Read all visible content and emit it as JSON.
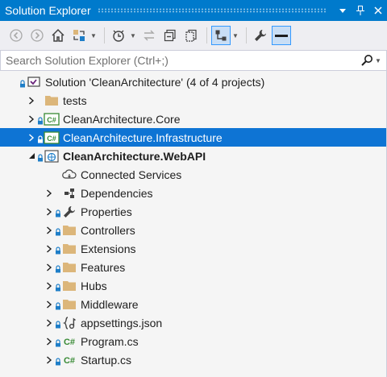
{
  "window": {
    "title": "Solution Explorer",
    "pin_glyph": "▾",
    "autohide_glyph": "⊥",
    "close_glyph": "✕"
  },
  "search": {
    "placeholder": "Search Solution Explorer (Ctrl+;)",
    "value": ""
  },
  "tree": [
    {
      "label": "Solution 'CleanArchitecture' (4 of 4 projects)",
      "icon": "solution-icon",
      "indent": 0,
      "expander": "none",
      "lock": true,
      "selected": false,
      "bold": false
    },
    {
      "label": "tests",
      "icon": "folder-icon",
      "indent": 1,
      "expander": "collapsed",
      "lock": false,
      "selected": false,
      "bold": false
    },
    {
      "label": "CleanArchitecture.Core",
      "icon": "csharp-project-icon",
      "indent": 1,
      "expander": "collapsed",
      "lock": true,
      "selected": false,
      "bold": false
    },
    {
      "label": "CleanArchitecture.Infrastructure",
      "icon": "csharp-project-icon",
      "indent": 1,
      "expander": "collapsed",
      "lock": true,
      "selected": true,
      "bold": false
    },
    {
      "label": "CleanArchitecture.WebAPI",
      "icon": "web-project-icon",
      "indent": 1,
      "expander": "expanded",
      "lock": true,
      "selected": false,
      "bold": true
    },
    {
      "label": "Connected Services",
      "icon": "connected-services-icon",
      "indent": 2,
      "expander": "none",
      "lock": false,
      "selected": false,
      "bold": false
    },
    {
      "label": "Dependencies",
      "icon": "dependencies-icon",
      "indent": 2,
      "expander": "collapsed",
      "lock": false,
      "selected": false,
      "bold": false
    },
    {
      "label": "Properties",
      "icon": "wrench-icon",
      "indent": 2,
      "expander": "collapsed",
      "lock": true,
      "selected": false,
      "bold": false
    },
    {
      "label": "Controllers",
      "icon": "folder-icon",
      "indent": 2,
      "expander": "collapsed",
      "lock": true,
      "selected": false,
      "bold": false
    },
    {
      "label": "Extensions",
      "icon": "folder-icon",
      "indent": 2,
      "expander": "collapsed",
      "lock": true,
      "selected": false,
      "bold": false
    },
    {
      "label": "Features",
      "icon": "folder-icon",
      "indent": 2,
      "expander": "collapsed",
      "lock": true,
      "selected": false,
      "bold": false
    },
    {
      "label": "Hubs",
      "icon": "folder-icon",
      "indent": 2,
      "expander": "collapsed",
      "lock": true,
      "selected": false,
      "bold": false
    },
    {
      "label": "Middleware",
      "icon": "folder-icon",
      "indent": 2,
      "expander": "collapsed",
      "lock": true,
      "selected": false,
      "bold": false
    },
    {
      "label": "appsettings.json",
      "icon": "json-file-icon",
      "indent": 2,
      "expander": "collapsed",
      "lock": true,
      "selected": false,
      "bold": false
    },
    {
      "label": "Program.cs",
      "icon": "csharp-file-icon",
      "indent": 2,
      "expander": "collapsed",
      "lock": true,
      "selected": false,
      "bold": false
    },
    {
      "label": "Startup.cs",
      "icon": "csharp-file-icon",
      "indent": 2,
      "expander": "collapsed",
      "lock": true,
      "selected": false,
      "bold": false
    }
  ],
  "colors": {
    "titlebar": "#007acc",
    "selection": "#0e74d4",
    "folder": "#dcb67a",
    "csharp": "#388a34",
    "lock": "#1e7ec8"
  }
}
